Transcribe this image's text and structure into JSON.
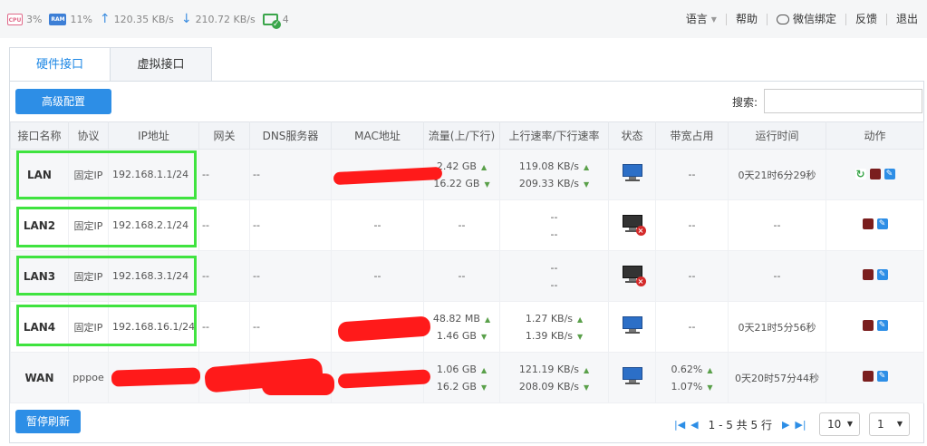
{
  "status": {
    "cpu_chip": "CPU",
    "cpu": "3%",
    "ram_chip": "RAM",
    "ram": "11%",
    "upload": "120.35 KB/s",
    "download": "210.72 KB/s",
    "devices": "4"
  },
  "topnav": {
    "language": "语言",
    "help": "帮助",
    "wechat": "微信绑定",
    "feedback": "反馈",
    "logout": "退出"
  },
  "tabs": [
    "硬件接口",
    "虚拟接口"
  ],
  "toolbar": {
    "advanced": "高级配置",
    "search_label": "搜索:",
    "search_value": ""
  },
  "table": {
    "headers": [
      "接口名称",
      "协议",
      "IP地址",
      "网关",
      "DNS服务器",
      "MAC地址",
      "流量(上/下行)",
      "上行速率/下行速率",
      "状态",
      "带宽占用",
      "运行时间",
      "动作"
    ],
    "rows": [
      {
        "name": "LAN",
        "proto": "固定IP",
        "ip": "192.168.1.1/24",
        "gw": "--",
        "dns": "--",
        "mac": "",
        "traffic_up": "2.42 GB",
        "traffic_down": "16.22 GB",
        "rate_up": "119.08 KB/s",
        "rate_down": "209.33 KB/s",
        "status": "online",
        "bw1": "--",
        "bw2": "",
        "uptime": "0天21时6分29秒"
      },
      {
        "name": "LAN2",
        "proto": "固定IP",
        "ip": "192.168.2.1/24",
        "gw": "--",
        "dns": "--",
        "mac": "--",
        "traffic_up": "--",
        "traffic_down": "",
        "rate_up": "--",
        "rate_down": "--",
        "status": "offline",
        "bw1": "--",
        "bw2": "",
        "uptime": "--"
      },
      {
        "name": "LAN3",
        "proto": "固定IP",
        "ip": "192.168.3.1/24",
        "gw": "--",
        "dns": "--",
        "mac": "--",
        "traffic_up": "--",
        "traffic_down": "",
        "rate_up": "--",
        "rate_down": "--",
        "status": "offline",
        "bw1": "--",
        "bw2": "",
        "uptime": "--"
      },
      {
        "name": "LAN4",
        "proto": "固定IP",
        "ip": "192.168.16.1/24",
        "gw": "--",
        "dns": "--",
        "mac": "",
        "traffic_up": "48.82 MB",
        "traffic_down": "1.46 GB",
        "rate_up": "1.27 KB/s",
        "rate_down": "1.39 KB/s",
        "status": "online",
        "bw1": "--",
        "bw2": "",
        "uptime": "0天21时5分56秒"
      },
      {
        "name": "WAN",
        "proto": "pppoe",
        "ip": "",
        "gw": "",
        "dns": "",
        "mac": "",
        "traffic_up": "1.06 GB",
        "traffic_down": "16.2 GB",
        "rate_up": "121.19 KB/s",
        "rate_down": "208.09 KB/s",
        "status": "online",
        "bw1": "0.62%",
        "bw2": "1.07%",
        "uptime": "0天20时57分44秒"
      }
    ]
  },
  "footer": {
    "pause": "暂停刷新",
    "page_info": "1 - 5 共 5 行",
    "page_size": "10",
    "page": "1"
  },
  "colors": {
    "accent": "#2d8ee6",
    "highlight_box": "#3fe33f",
    "redaction": "#ff1a1a"
  }
}
